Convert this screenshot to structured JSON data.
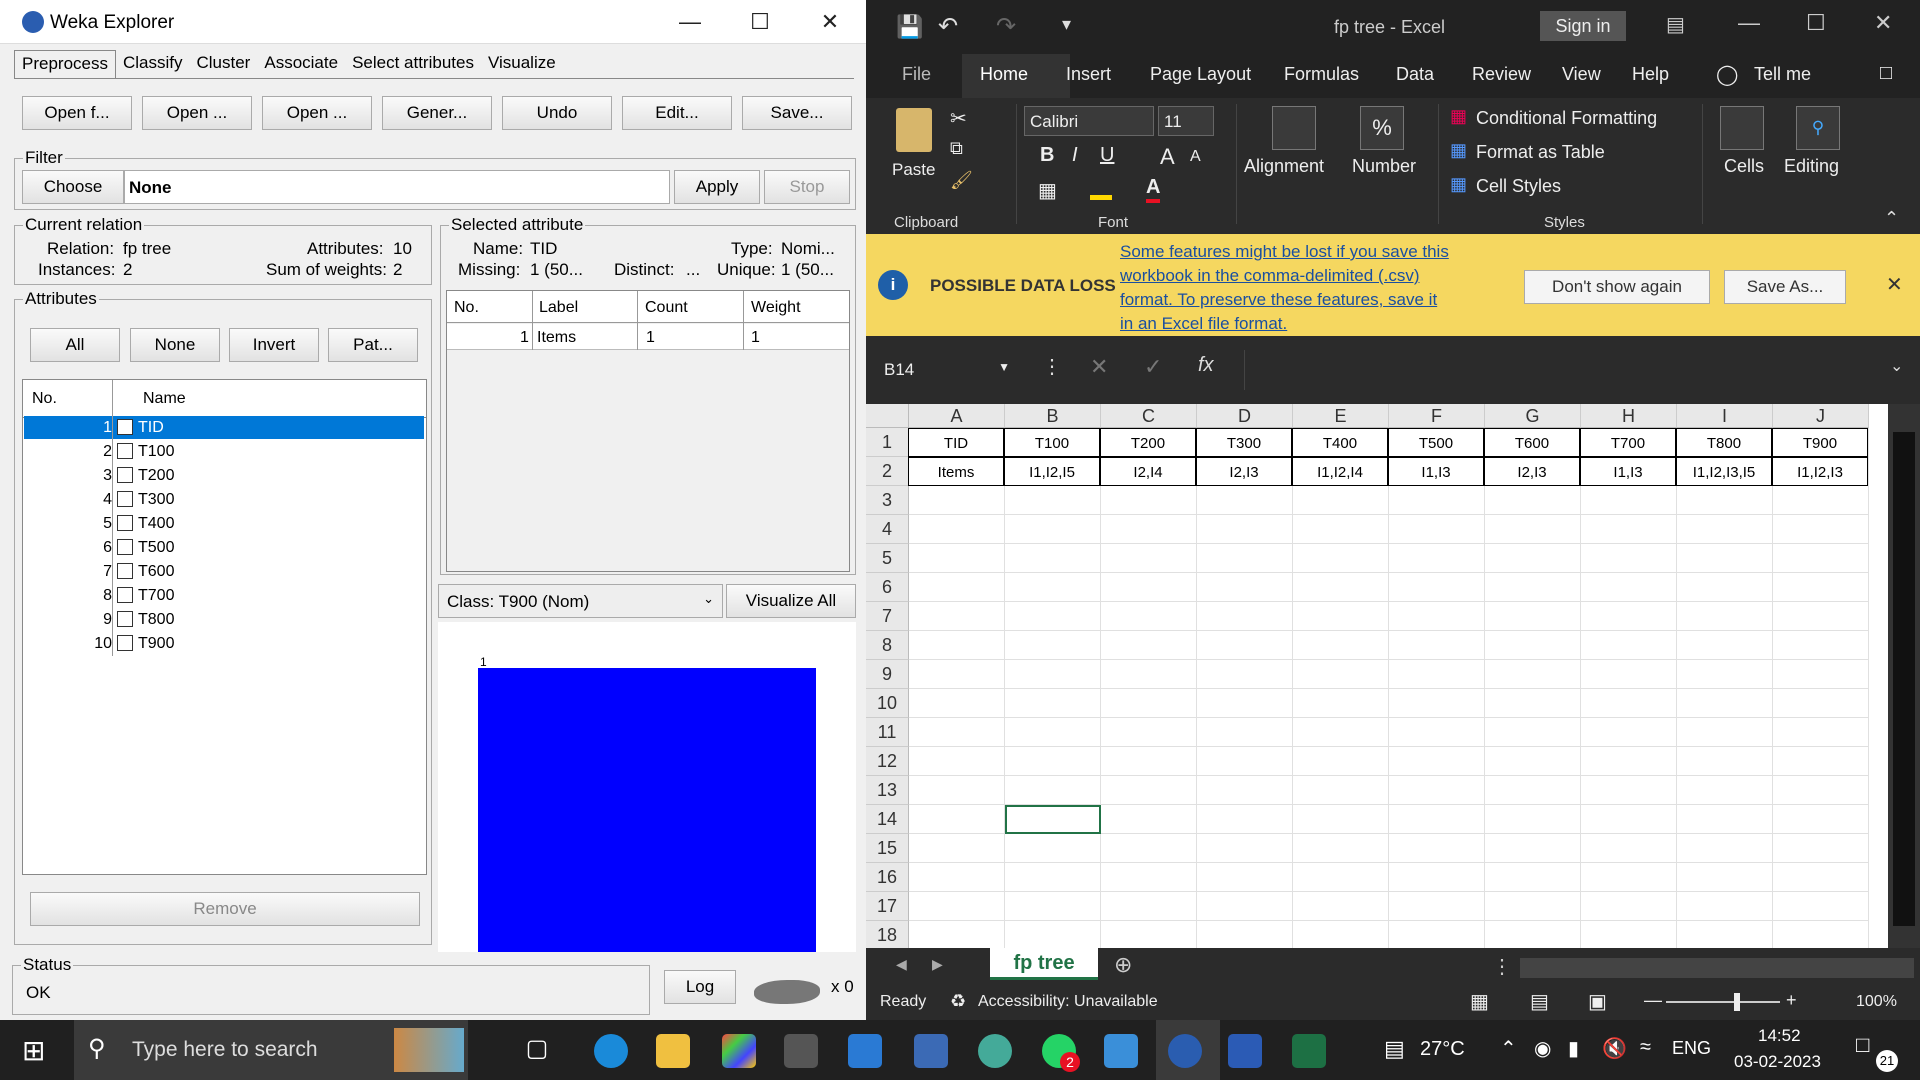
{
  "weka": {
    "title": "Weka Explorer",
    "tabs": [
      "Preprocess",
      "Classify",
      "Cluster",
      "Associate",
      "Select attributes",
      "Visualize"
    ],
    "buttons": [
      "Open f...",
      "Open ...",
      "Open ...",
      "Gener...",
      "Undo",
      "Edit...",
      "Save..."
    ],
    "filter": {
      "group_label": "Filter",
      "choose": "Choose",
      "value": "None",
      "apply": "Apply",
      "stop": "Stop"
    },
    "relation": {
      "group_label": "Current relation",
      "relation_label": "Relation:",
      "relation_value": "fp tree",
      "instances_label": "Instances:",
      "instances_value": "2",
      "attributes_label": "Attributes:",
      "attributes_value": "10",
      "weights_label": "Sum of weights:",
      "weights_value": "2"
    },
    "attributes": {
      "group_label": "Attributes",
      "buttons": [
        "All",
        "None",
        "Invert",
        "Pat..."
      ],
      "col_no": "No.",
      "col_name": "Name",
      "rows": [
        {
          "no": "1",
          "name": "TID"
        },
        {
          "no": "2",
          "name": "T100"
        },
        {
          "no": "3",
          "name": "T200"
        },
        {
          "no": "4",
          "name": "T300"
        },
        {
          "no": "5",
          "name": "T400"
        },
        {
          "no": "6",
          "name": "T500"
        },
        {
          "no": "7",
          "name": "T600"
        },
        {
          "no": "8",
          "name": "T700"
        },
        {
          "no": "9",
          "name": "T800"
        },
        {
          "no": "10",
          "name": "T900"
        }
      ],
      "remove": "Remove"
    },
    "selected": {
      "group_label": "Selected attribute",
      "name_label": "Name:",
      "name_value": "TID",
      "type_label": "Type:",
      "type_value": "Nomi...",
      "missing_label": "Missing:",
      "missing_value": "1 (50...",
      "distinct_label": "Distinct:",
      "distinct_value": "...",
      "unique_label": "Unique:",
      "unique_value": "1 (50...",
      "headers": [
        "No.",
        "Label",
        "Count",
        "Weight"
      ],
      "rows": [
        {
          "no": "1",
          "label": "Items",
          "count": "1",
          "weight": "1"
        }
      ]
    },
    "class_select": "Class: T900 (Nom)",
    "visualize_all": "Visualize All",
    "histogram": {
      "bar_label": "1",
      "bar_color": "#0000ff"
    },
    "status": {
      "group_label": "Status",
      "text": "OK",
      "log": "Log",
      "count": "x 0"
    }
  },
  "excel": {
    "title": "fp tree  -  Excel",
    "sign_in": "Sign in",
    "ribbon_tabs": [
      "File",
      "Home",
      "Insert",
      "Page Layout",
      "Formulas",
      "Data",
      "Review",
      "View",
      "Help",
      "Tell me"
    ],
    "active_tab": "Home",
    "clipboard": {
      "paste": "Paste",
      "label": "Clipboard"
    },
    "font": {
      "name": "Calibri",
      "size": "11",
      "label": "Font",
      "bold": "B",
      "italic": "I",
      "underline": "U",
      "grow": "A",
      "shrink": "A",
      "color_letter": "A",
      "font_color": "#e81123",
      "highlight_color": "#ffd800"
    },
    "alignment": "Alignment",
    "number": "Number",
    "styles": {
      "conditional": "Conditional Formatting",
      "format_table": "Format as Table",
      "cell_styles": "Cell Styles",
      "label": "Styles"
    },
    "cells": "Cells",
    "editing": "Editing",
    "warning": {
      "title": "POSSIBLE DATA LOSS",
      "message": "Some features might be lost if you save this workbook in the comma-delimited (.csv) format. To preserve these features, save it in an Excel file format.",
      "dont_show": "Don't show again",
      "save_as": "Save As..."
    },
    "name_box": "B14",
    "fx": "fx",
    "columns": [
      "A",
      "B",
      "C",
      "D",
      "E",
      "F",
      "G",
      "H",
      "I",
      "J"
    ],
    "rows": [
      [
        "TID",
        "T100",
        "T200",
        "T300",
        "T400",
        "T500",
        "T600",
        "T700",
        "T800",
        "T900"
      ],
      [
        "Items",
        "I1,I2,I5",
        "I2,I4",
        "I2,I3",
        "I1,I2,I4",
        "I1,I3",
        "I2,I3",
        "I1,I3",
        "I1,I2,I3,I5",
        "I1,I2,I3"
      ]
    ],
    "row_numbers": [
      "1",
      "2",
      "3",
      "4",
      "5",
      "6",
      "7",
      "8",
      "9",
      "10",
      "11",
      "12",
      "13",
      "14",
      "15",
      "16",
      "17",
      "18"
    ],
    "sheet_tab": "fp tree",
    "status": "Ready",
    "accessibility": "Accessibility: Unavailable",
    "zoom": "100%",
    "sheet_accent": "#217346"
  },
  "taskbar": {
    "search_placeholder": "Type here to search",
    "temperature": "27°C",
    "language": "ENG",
    "time": "14:52",
    "date": "03-02-2023",
    "whatsapp_badge": "2",
    "notifications": "21"
  }
}
